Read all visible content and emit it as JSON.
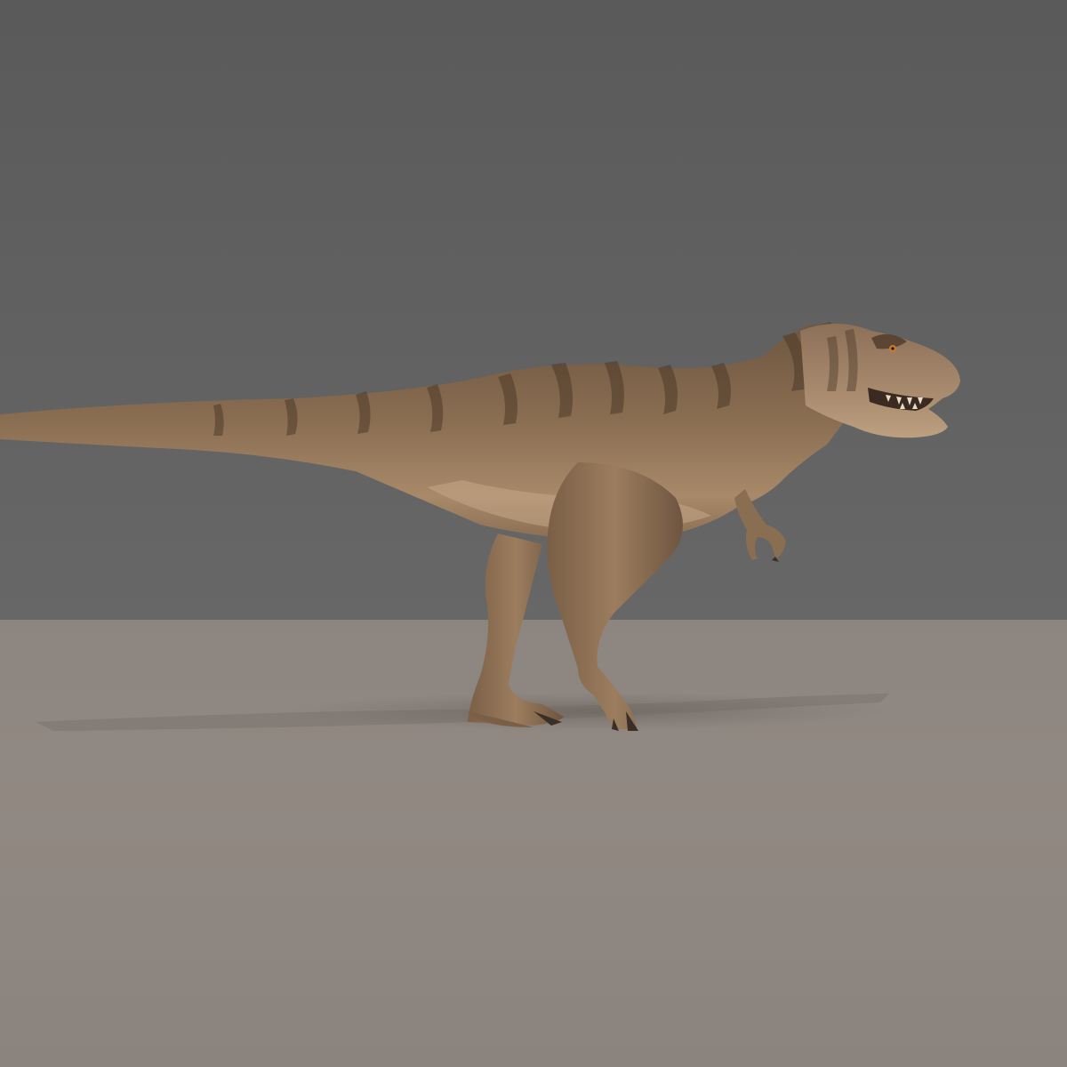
{
  "scene": {
    "subject": "tyrannosaurus",
    "colors": {
      "backdrop_top": "#5a5a5a",
      "backdrop_bottom": "#676767",
      "floor_near": "#908780",
      "floor_far": "#8a847e",
      "skin_base": "#8a6e52",
      "skin_light": "#b89a78",
      "skin_dark": "#4e3a28",
      "belly": "#c4a888",
      "claw": "#3a2e28",
      "shadow": "#6f6862"
    }
  }
}
